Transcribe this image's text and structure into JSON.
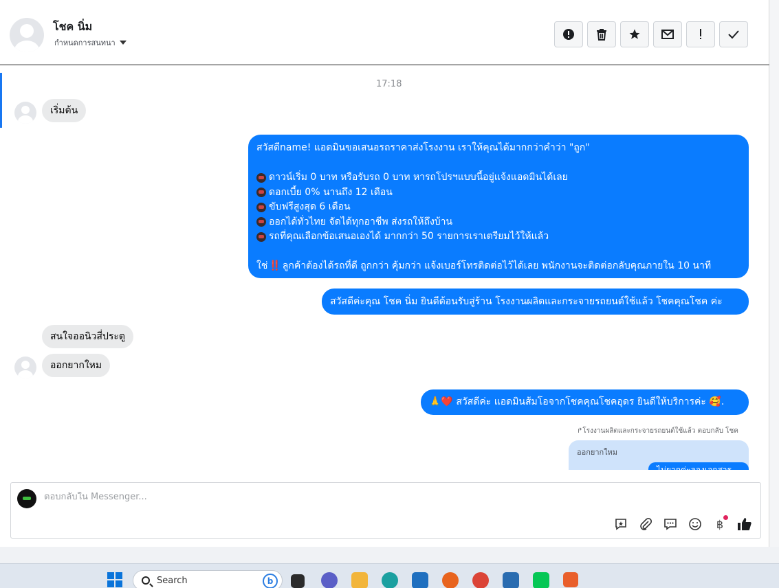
{
  "header": {
    "name": "โชค นิ่ม",
    "subtitle": "กำหนดการสนทนา",
    "actions": [
      {
        "icon": "alert-circle-icon",
        "glyph": "!"
      },
      {
        "icon": "trash-icon",
        "glyph": "🗑"
      },
      {
        "icon": "star-icon",
        "glyph": "★"
      },
      {
        "icon": "envelope-icon",
        "glyph": "✉"
      },
      {
        "icon": "exclamation-icon",
        "glyph": "!"
      },
      {
        "icon": "check-icon",
        "glyph": "✓"
      }
    ]
  },
  "conversation": {
    "timestamp": "17:18",
    "start_message": "เริ่มต้น",
    "welcome": {
      "intro": "สวัสดีname! แอดมินขอเสนอรถราคาส่งโรงงาน เราให้คุณได้มากกว่าคำว่า \"ถูก\"",
      "bullets": [
        "ดาวน์เริ่ม 0 บาท หรือรับรถ 0 บาท หารถโปรฯแบบนี้อยู่แจ้งแอดมินได้เลย",
        "ดอกเบี้ย 0% นานถึง 12 เดือน",
        "ขับฟรีสูงสุด 6 เดือน",
        "ออกได้ทั่วไทย จัดได้ทุกอาชีพ ส่งรถให้ถึงบ้าน",
        "รถที่คุณเลือกข้อเสนอเองได้ มากกว่า 50 รายการเราเตรียมไว้ให้แล้ว"
      ],
      "closing_prefix": "ใช่",
      "closing_mark": "‼️",
      "closing": "ลูกค้าต้องได้รถที่ดี ถูกกว่า คุ้มกว่า แจ้งเบอร์โทรติดต่อไว้ได้เลย พนักงานจะติดต่อกลับคุณภายใน 10 นาที"
    },
    "greeting": "สวัสดีค่ะคุณ โชค นิ่ม ยินดีต้อนรับสู่ร้าน โรงงานผลิตและกระจายรถยนต์ใช้แล้ว โชคคุณโชค ค่ะ",
    "user_msg_1": "สนใจออนิวสี่ประตู",
    "user_msg_2": "ออกยากใหม",
    "admin_reply": "🙏❤️ สวัสดีค่ะ แอดมินส้มโอจากโชคคุณโชคอุดร ยินดีให้บริการค่ะ 🥰.",
    "reply_note": "↱โรงงานผลิตและกระจายรถยนต์ใช้แล้ว ตอบกลับ โชค",
    "reply_quote": "ออกยากใหม",
    "partial_reply": "ไม่ยากค่ะลองเอกสาร"
  },
  "composer": {
    "placeholder": "ตอบกลับใน Messenger..."
  },
  "taskbar": {
    "search_label": "Search",
    "bing_label": "b"
  },
  "colors": {
    "accent": "#1877f2",
    "bubble_out": "#0a7cff",
    "bubble_in": "#e9eaeb"
  }
}
